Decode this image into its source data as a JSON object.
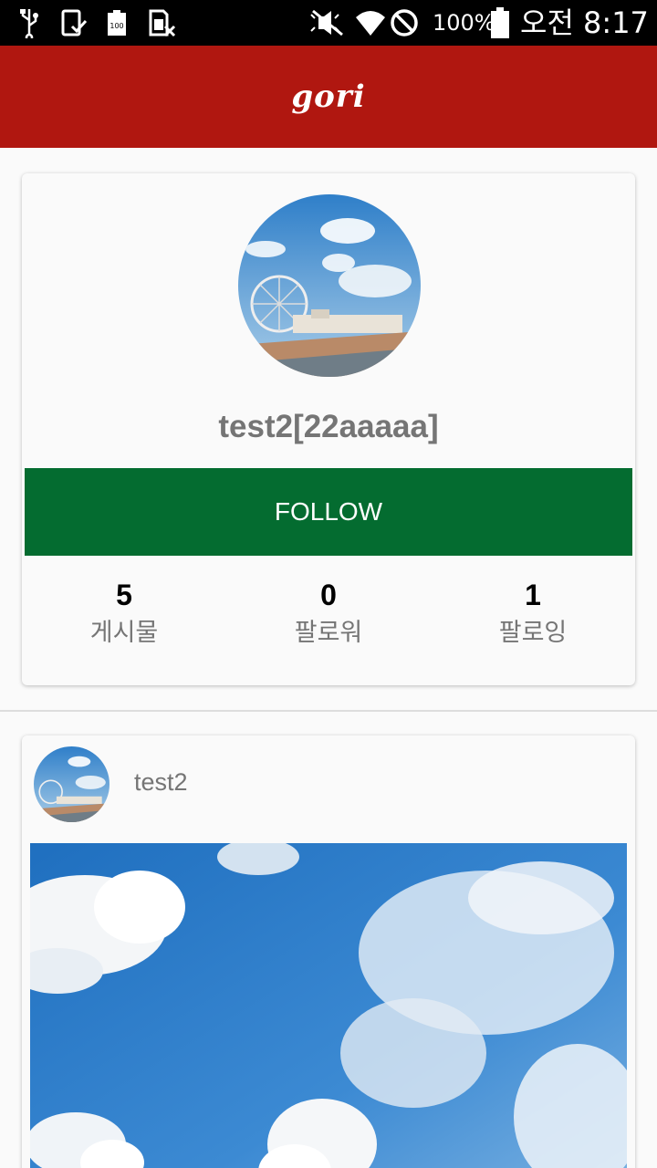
{
  "status_bar": {
    "battery_percent": "100%",
    "time": "오전 8:17",
    "icons": [
      "usb-icon",
      "download-done-icon",
      "battery-saver-icon",
      "sim-off-icon",
      "mute-icon",
      "wifi-icon",
      "do-not-disturb-icon",
      "battery-icon"
    ]
  },
  "app_bar": {
    "title": "gori",
    "color": "#b01710"
  },
  "profile": {
    "username": "test2[22aaaaa]",
    "follow_label": "FOLLOW",
    "follow_color": "#046c30",
    "stats": [
      {
        "count": "5",
        "label": "게시물"
      },
      {
        "count": "0",
        "label": "팔로워"
      },
      {
        "count": "1",
        "label": "팔로잉"
      }
    ]
  },
  "post": {
    "author": "test2"
  }
}
